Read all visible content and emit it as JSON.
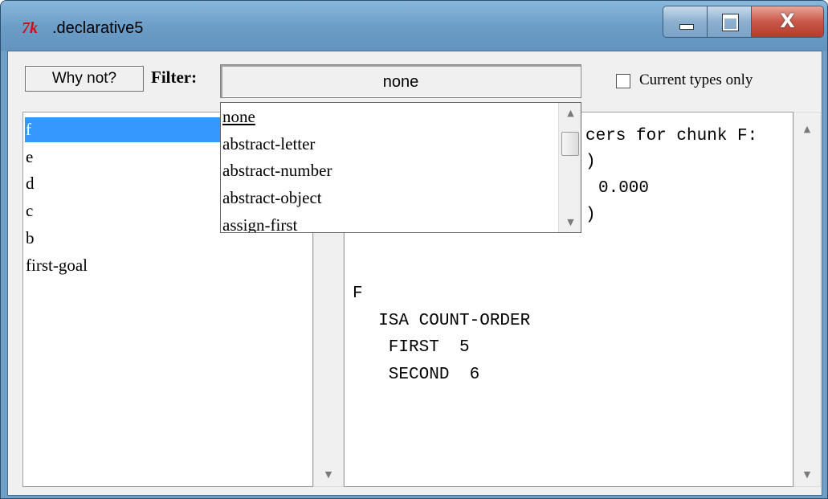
{
  "window": {
    "title": ".declarative5",
    "icon_text": "7k",
    "close_glyph": "X",
    "colors": {
      "titlebar": "#6f9fc7",
      "selection": "#3399ff",
      "close_button": "#c9584a"
    }
  },
  "toolbar": {
    "why_not_label": "Why not?",
    "filter_label": "Filter:",
    "filter_value": "none",
    "current_types_label": "Current types only",
    "current_types_checked": false
  },
  "chunk_list": {
    "items": [
      "f",
      "e",
      "d",
      "c",
      "b",
      "first-goal"
    ],
    "selected": "f"
  },
  "filter_dropdown": {
    "options": [
      "none",
      "abstract-letter",
      "abstract-number",
      "abstract-object",
      "assign-first"
    ]
  },
  "detail_text": {
    "visible_lines": [
      "cers for chunk F:",
      ")",
      "0.000",
      ")",
      "F",
      "  ISA COUNT-ORDER",
      "   FIRST  5",
      "   SECOND  6"
    ]
  },
  "icons": {
    "scroll_up": "▲",
    "scroll_down": "▼",
    "minimize": "minimize-icon",
    "maximize": "maximize-icon",
    "close": "close-icon"
  }
}
